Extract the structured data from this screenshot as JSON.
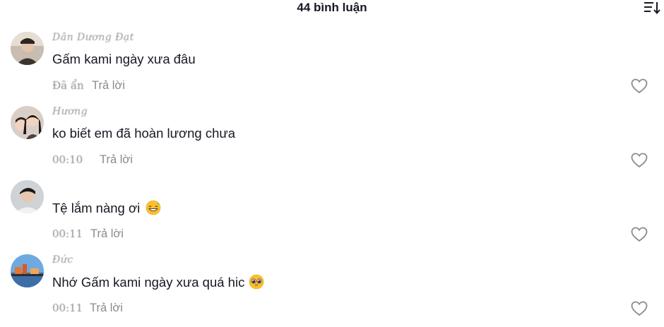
{
  "header": {
    "title": "44 bình luận",
    "sort_icon": "sort-icon"
  },
  "comments": [
    {
      "username": "Dân Dương Đạt",
      "text": "Gấm kami ngày xưa đâu",
      "time": "Đã ẩn",
      "reply": "Trả lời",
      "like_icon": "heart-outline-icon"
    },
    {
      "username": "Hương",
      "text": "ko biết em đã hoàn lương chưa",
      "time": "00:10",
      "reply": "Trả lời",
      "like_icon": "heart-outline-icon"
    },
    {
      "username": "",
      "text": "Tệ lắm nàng ơi",
      "emoji": "grinning-sweat-emoji",
      "time": "00:11",
      "reply": "Trả lời",
      "like_icon": "heart-outline-icon"
    },
    {
      "username": "Đức",
      "text": "Nhớ Gấm kami ngày xưa quá hic",
      "emoji": "pleading-face-emoji",
      "time": "00:11",
      "reply": "Trả lời",
      "like_icon": "heart-outline-icon"
    }
  ]
}
